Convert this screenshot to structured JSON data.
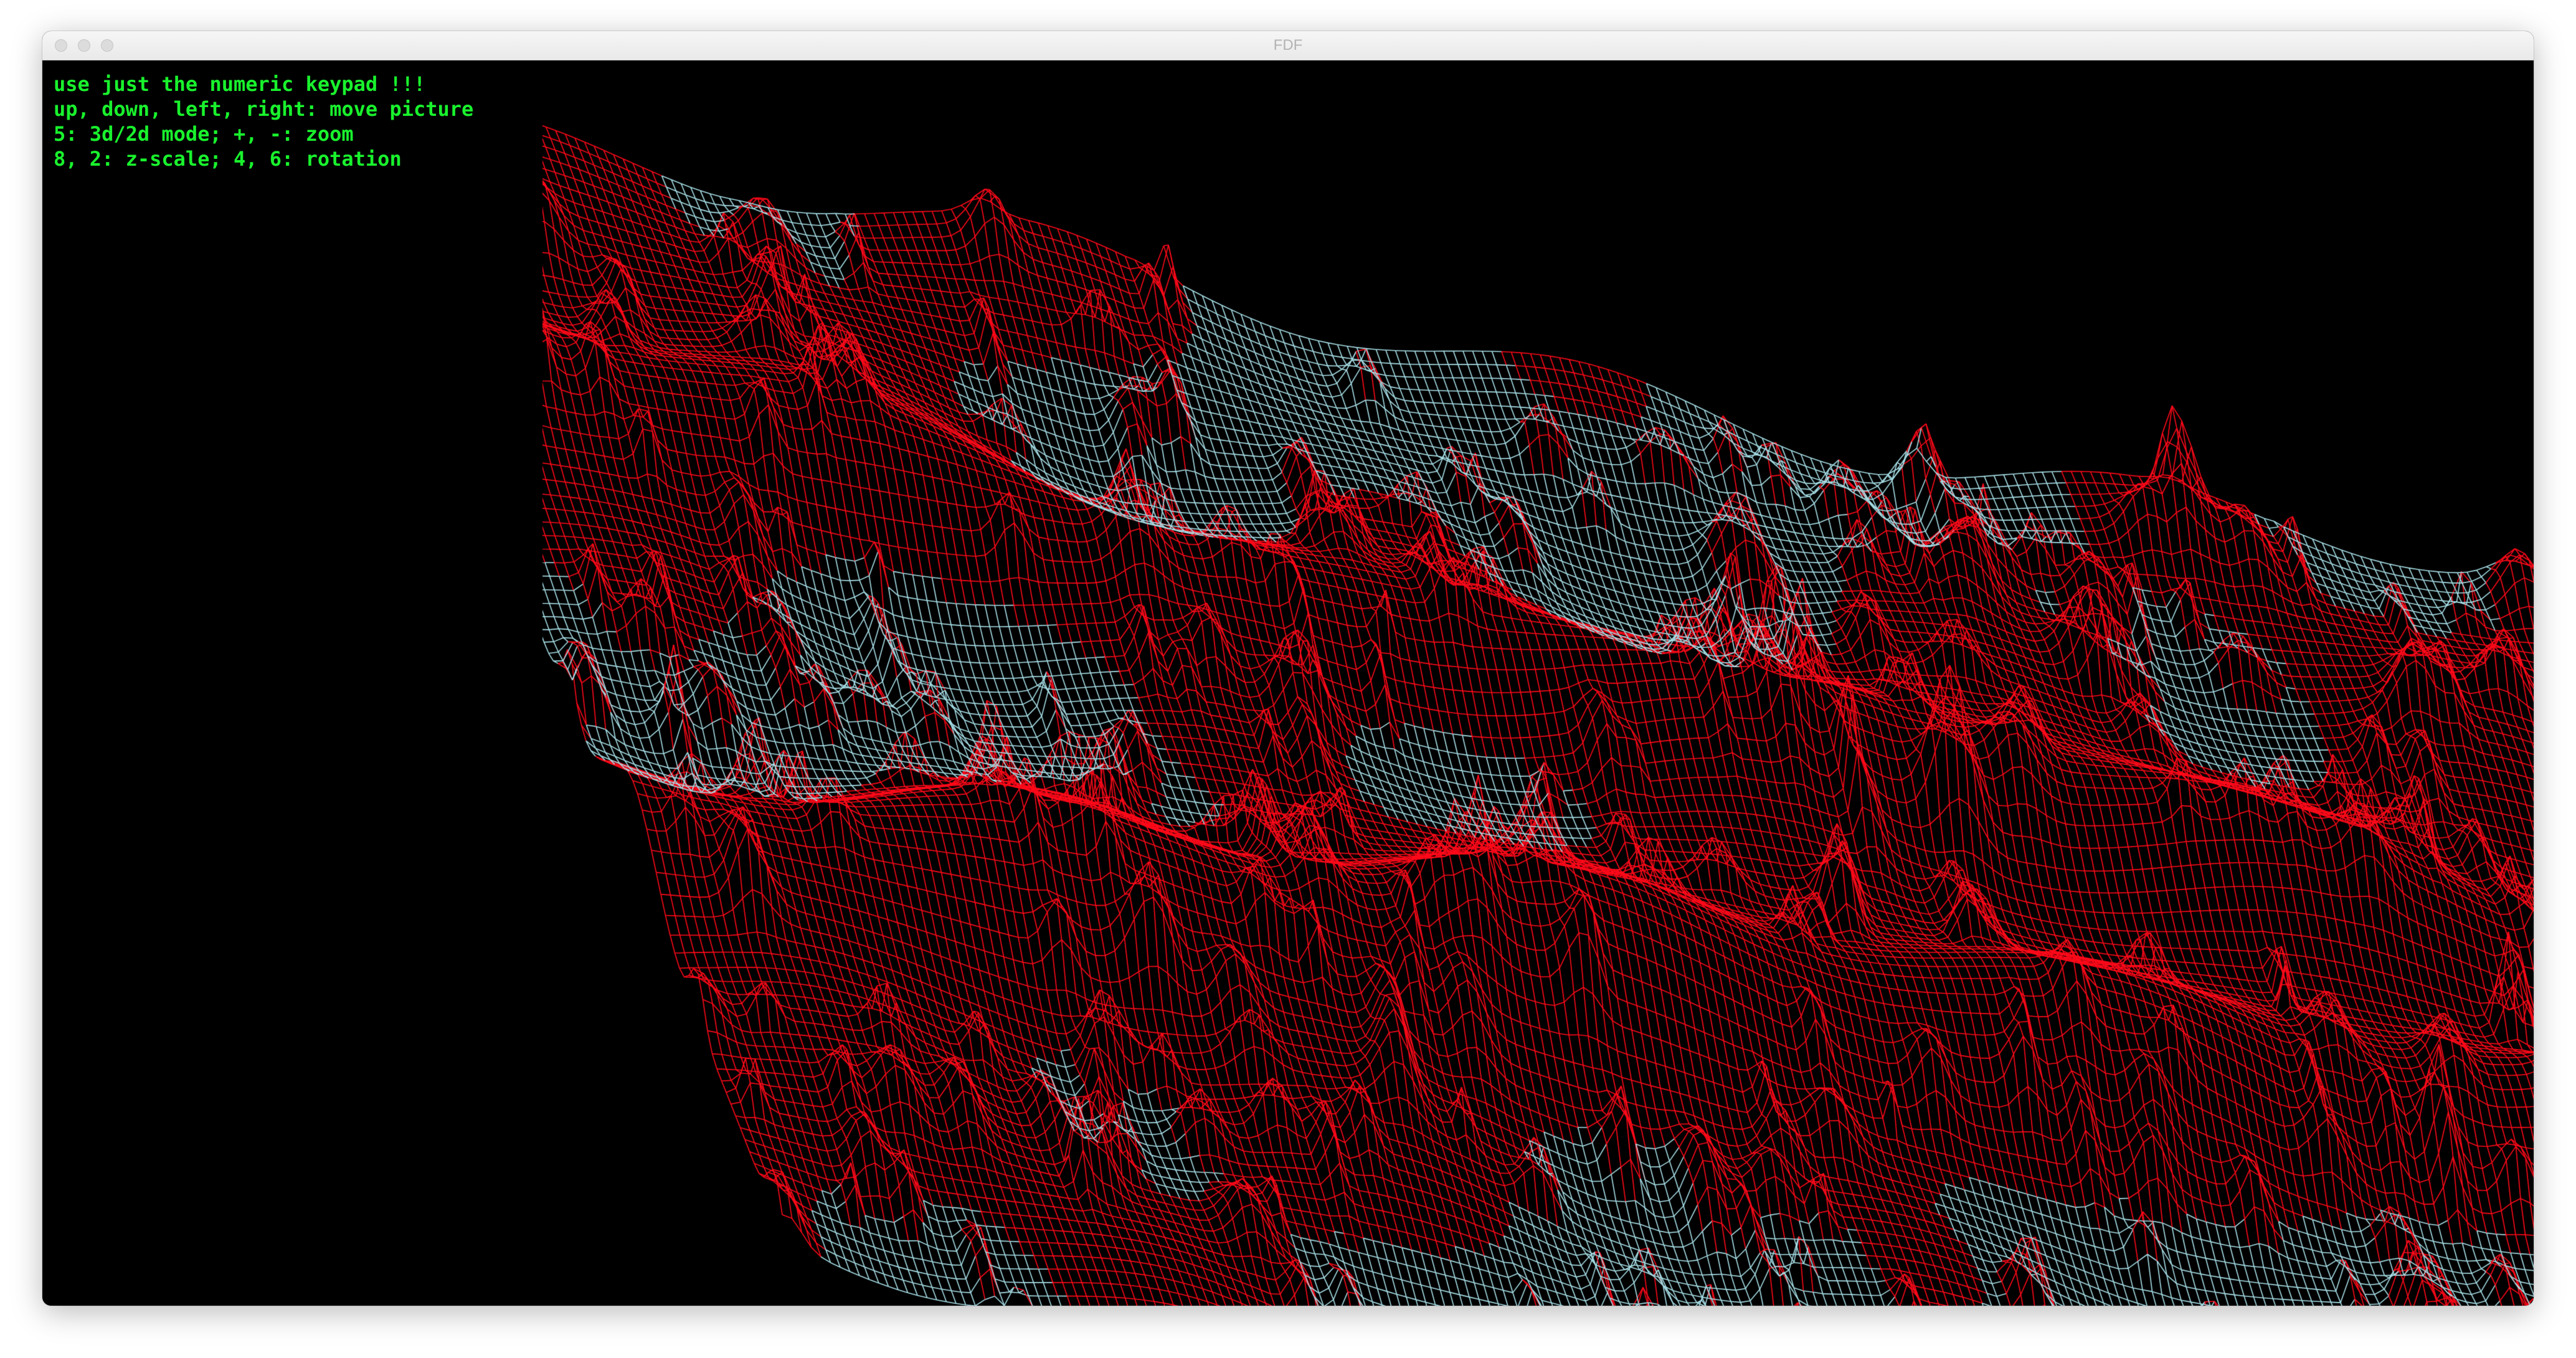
{
  "window": {
    "title": "FDF",
    "controls": [
      "close",
      "minimize",
      "zoom"
    ]
  },
  "help": {
    "lines": [
      "use just the numeric keypad !!!",
      "up, down, left, right: move picture",
      "5: 3d/2d mode; +, -: zoom",
      "8, 2: z-scale; 4, 6: rotation"
    ]
  },
  "colors": {
    "background": "#000000",
    "wire": "#ff0a1a",
    "wire_dense": "#ff1f2a",
    "flat_wire": "#a8e0e8",
    "help_text": "#19f22d"
  }
}
